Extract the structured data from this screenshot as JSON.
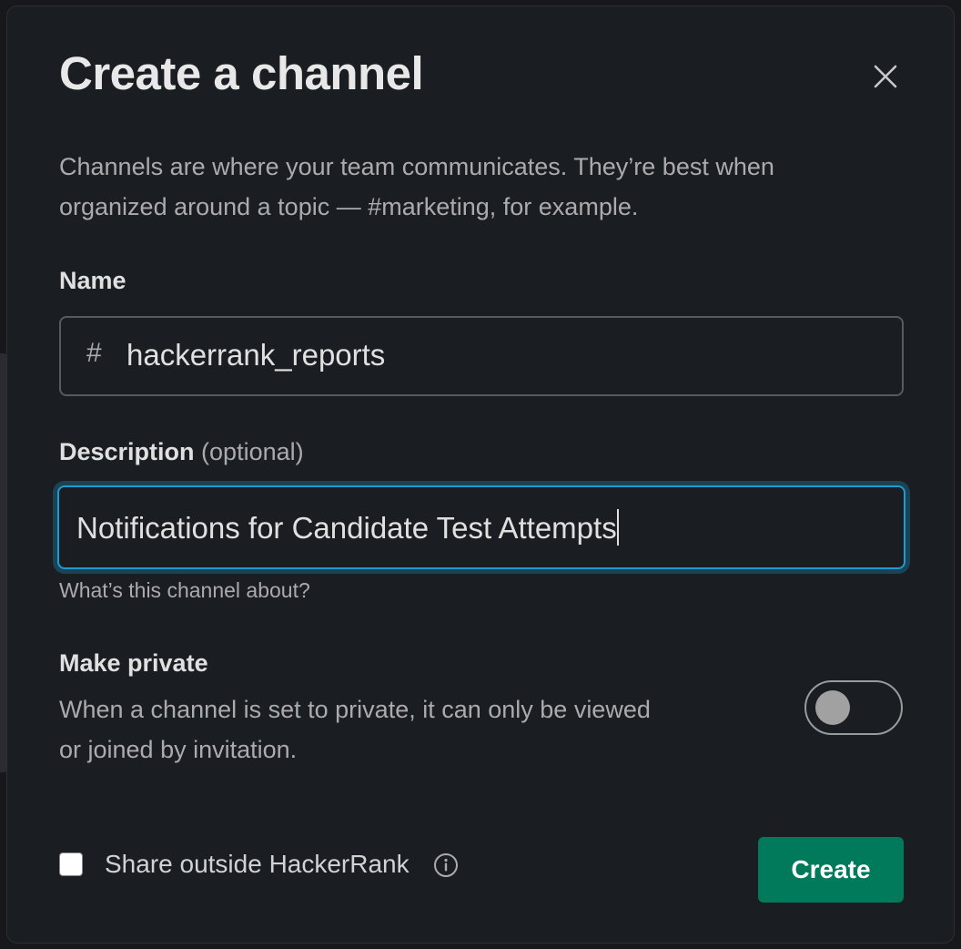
{
  "modal": {
    "title": "Create a channel",
    "intro": "Channels are where your team communicates. They’re best when organized around a topic — #marketing, for example.",
    "close_icon": "close-icon"
  },
  "name_field": {
    "label": "Name",
    "prefix": "#",
    "value": "hackerrank_reports"
  },
  "description_field": {
    "label": "Description",
    "optional_label": "(optional)",
    "value": "Notifications for Candidate Test Attempts",
    "hint": "What’s this channel about?"
  },
  "privacy": {
    "label": "Make private",
    "description": "When a channel is set to private, it can only be viewed or joined by invitation.",
    "enabled": false
  },
  "footer": {
    "share_label": "Share outside HackerRank",
    "share_checked": false,
    "info_icon": "info-icon",
    "create_label": "Create"
  },
  "colors": {
    "modal_bg": "#1a1d21",
    "focus_ring": "#1d9bd1",
    "primary_button": "#007a5a"
  }
}
